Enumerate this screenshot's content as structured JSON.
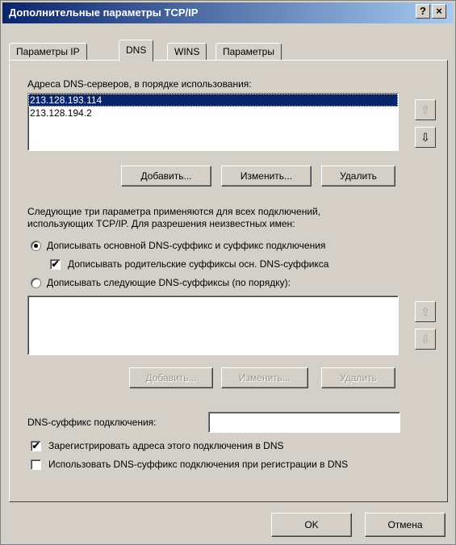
{
  "window": {
    "title": "Дополнительные параметры TCP/IP",
    "help_glyph": "?",
    "close_glyph": "×"
  },
  "tabs": [
    {
      "label": "Параметры IP",
      "active": false
    },
    {
      "label": "DNS",
      "active": true
    },
    {
      "label": "WINS",
      "active": false
    },
    {
      "label": "Параметры",
      "active": false
    }
  ],
  "dns_servers": {
    "label": "Адреса DNS-серверов, в порядке использования:",
    "items": [
      "213.128.193.114",
      "213.128.194.2"
    ],
    "selected_index": 0,
    "up_icon": "⇧",
    "down_icon": "⇩"
  },
  "server_buttons": {
    "add": "Добавить...",
    "edit": "Изменить...",
    "remove": "Удалить"
  },
  "description": {
    "line1": "Следующие три параметра применяются для всех подключений,",
    "line2": "использующих TCP/IP. Для разрешения неизвестных имен:"
  },
  "options": {
    "radio_primary": "Дописывать основной DNS-суффикс и суффикс подключения",
    "check_parent": "Дописывать родительские суффиксы осн. DNS-суффикса",
    "radio_following": "Дописывать следующие DNS-суффиксы (по порядку):",
    "radio_primary_checked": true,
    "check_parent_checked": true,
    "radio_following_checked": false
  },
  "suffix_list": {
    "items": [],
    "up_icon": "⇧",
    "down_icon": "⇩"
  },
  "suffix_buttons": {
    "add": "Добавить...",
    "edit": "Изменить...",
    "remove": "Удалить"
  },
  "connection_suffix": {
    "label": "DNS-суффикс подключения:",
    "value": ""
  },
  "checks": {
    "register": "Зарегистрировать адреса этого подключения в DNS",
    "register_checked": true,
    "use_suffix": "Использовать DNS-суффикс подключения при регистрации в DNS",
    "use_suffix_checked": false
  },
  "footer": {
    "ok": "OK",
    "cancel": "Отмена"
  },
  "check_glyph": "✔"
}
